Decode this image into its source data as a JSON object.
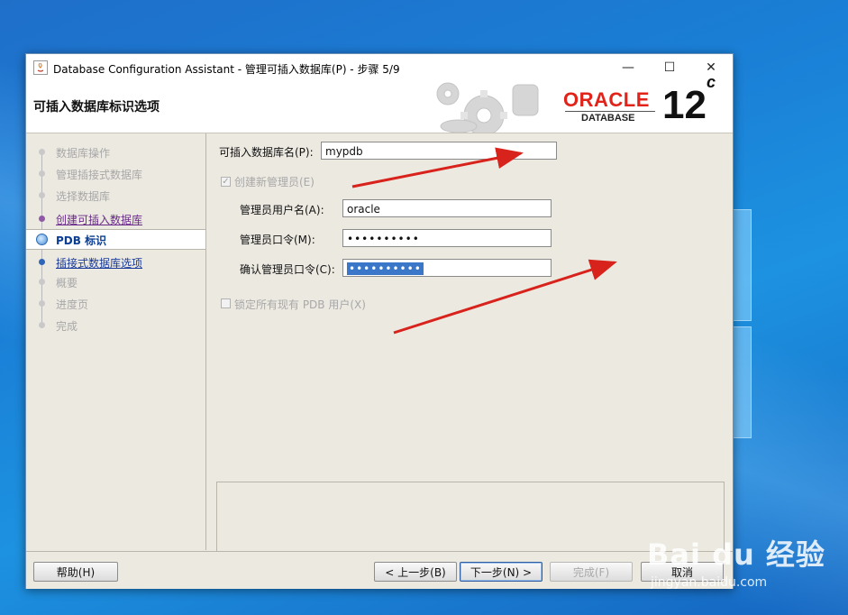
{
  "window": {
    "title": "Database Configuration Assistant - 管理可插入数据库(P) - 步骤 5/9",
    "controls": {
      "minimize": "—",
      "maximize": "☐",
      "close": "✕"
    }
  },
  "header": {
    "title": "可插入数据库标识选项",
    "brand": "ORACLE",
    "brand_sub": "DATABASE",
    "version": "12",
    "version_suffix": "c"
  },
  "steps": [
    {
      "label": "数据库操作",
      "state": "disabled"
    },
    {
      "label": "管理插接式数据库",
      "state": "disabled"
    },
    {
      "label": "选择数据库",
      "state": "disabled"
    },
    {
      "label": "创建可插入数据库",
      "state": "visited"
    },
    {
      "label": "PDB 标识",
      "state": "current"
    },
    {
      "label": "插接式数据库选项",
      "state": "link"
    },
    {
      "label": "概要",
      "state": "disabled"
    },
    {
      "label": "进度页",
      "state": "disabled"
    },
    {
      "label": "完成",
      "state": "disabled"
    }
  ],
  "form": {
    "pdb_name_label": "可插入数据库名(P):",
    "pdb_name_value": "mypdb",
    "create_admin_label": "创建新管理员(E)",
    "create_admin_checked": true,
    "admin_user_label": "管理员用户名(A):",
    "admin_user_value": "oracle",
    "admin_pw_label": "管理员口令(M):",
    "admin_pw_value": "••••••••••",
    "confirm_pw_label": "确认管理员口令(C):",
    "confirm_pw_value": "••••••••••",
    "lock_users_label": "锁定所有现有 PDB 用户(X)",
    "lock_users_checked": false
  },
  "buttons": {
    "help": "帮助(H)",
    "back": "< 上一步(B)",
    "next": "下一步(N) >",
    "finish": "完成(F)",
    "cancel": "取消"
  },
  "watermark": {
    "brand": "Bai du 经验",
    "url": "jingyan.baidu.com"
  },
  "colors": {
    "oracle_red": "#e2231a",
    "annotation_arrow": "#d8231c",
    "selection": "#3a77c9"
  }
}
